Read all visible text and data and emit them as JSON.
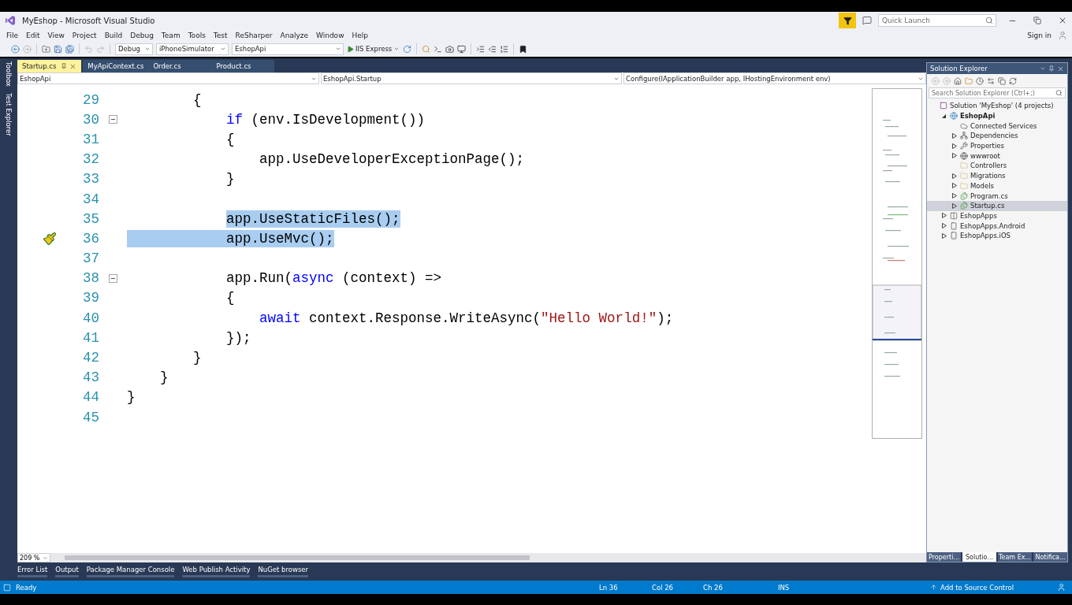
{
  "window": {
    "title": "MyEshop - Microsoft Visual Studio",
    "quick_launch": {
      "placeholder": "Quick Launch"
    },
    "sign_in": "Sign in"
  },
  "menu": [
    "File",
    "Edit",
    "View",
    "Project",
    "Build",
    "Debug",
    "Team",
    "Tools",
    "Test",
    "ReSharper",
    "Analyze",
    "Window",
    "Help"
  ],
  "toolbar": {
    "combos": [
      "Debug",
      "iPhoneSimulator",
      "EshopApi"
    ],
    "run": "IIS Express"
  },
  "side_tabs": [
    "Toolbox",
    "Test Explorer"
  ],
  "doc_tabs": [
    {
      "label": "Startup.cs",
      "selected": true
    },
    {
      "label": "MyApiContext.cs",
      "selected": false
    },
    {
      "label": "Order.cs",
      "selected": false
    },
    {
      "label": "Product.cs",
      "selected": false
    }
  ],
  "nav_bar": [
    "EshopApi",
    "EshopApi.Startup",
    "Configure(IApplicationBuilder app, IHostingEnvironment env)"
  ],
  "code": {
    "lines": [
      {
        "number": "29",
        "foldable": false,
        "marker": false,
        "selected": false,
        "tokens": [
          {
            "kind": "plain",
            "text": "        {"
          }
        ]
      },
      {
        "number": "30",
        "foldable": true,
        "marker": false,
        "selected": false,
        "tokens": [
          {
            "kind": "keyword",
            "text": "            if"
          },
          {
            "kind": "plain",
            "text": " (env.IsDevelopment())"
          }
        ]
      },
      {
        "number": "31",
        "foldable": false,
        "marker": false,
        "selected": false,
        "tokens": [
          {
            "kind": "plain",
            "text": "            {"
          }
        ]
      },
      {
        "number": "32",
        "foldable": false,
        "marker": false,
        "selected": false,
        "tokens": [
          {
            "kind": "plain",
            "text": "                app.UseDeveloperExceptionPage();"
          }
        ]
      },
      {
        "number": "33",
        "foldable": false,
        "marker": false,
        "selected": false,
        "tokens": [
          {
            "kind": "plain",
            "text": "            }"
          }
        ]
      },
      {
        "number": "34",
        "foldable": false,
        "marker": false,
        "selected": false
      },
      {
        "number": "35",
        "foldable": false,
        "marker": false,
        "selected": true,
        "full_line_selected": false,
        "tokens": [
          {
            "kind": "plain",
            "text": "            app.UseStaticFiles();"
          }
        ]
      },
      {
        "number": "36",
        "foldable": false,
        "marker": true,
        "selected": true,
        "full_line_selected": true,
        "tokens": [
          {
            "kind": "plain",
            "text": "            app.UseMvc();"
          }
        ]
      },
      {
        "number": "37",
        "foldable": false,
        "marker": false,
        "selected": false
      },
      {
        "number": "38",
        "foldable": true,
        "marker": false,
        "selected": false,
        "tokens": [
          {
            "kind": "plain",
            "text": "            app.Run("
          },
          {
            "kind": "keyword",
            "text": "async"
          },
          {
            "kind": "plain",
            "text": " (context) =>"
          }
        ]
      },
      {
        "number": "39",
        "foldable": false,
        "marker": false,
        "selected": false,
        "tokens": [
          {
            "kind": "plain",
            "text": "            {"
          }
        ]
      },
      {
        "number": "40",
        "foldable": false,
        "marker": false,
        "selected": false,
        "tokens": [
          {
            "kind": "keyword",
            "text": "                await"
          },
          {
            "kind": "plain",
            "text": " context.Response.WriteAsync("
          },
          {
            "kind": "string",
            "text": "\"Hello World!\""
          },
          {
            "kind": "plain",
            "text": ");"
          }
        ]
      },
      {
        "number": "41",
        "foldable": false,
        "marker": false,
        "selected": false,
        "tokens": [
          {
            "kind": "plain",
            "text": "            });"
          }
        ]
      },
      {
        "number": "42",
        "foldable": false,
        "marker": false,
        "selected": false,
        "tokens": [
          {
            "kind": "plain",
            "text": "        }"
          }
        ]
      },
      {
        "number": "43",
        "foldable": false,
        "marker": false,
        "selected": false,
        "tokens": [
          {
            "kind": "plain",
            "text": "    }"
          }
        ]
      },
      {
        "number": "44",
        "foldable": false,
        "marker": false,
        "selected": false,
        "tokens": [
          {
            "kind": "plain",
            "text": "}"
          }
        ]
      },
      {
        "number": "45",
        "foldable": false,
        "marker": false,
        "selected": false
      }
    ]
  },
  "zoom": "209 %",
  "solution_explorer": {
    "title": "Solution Explorer",
    "search": {
      "placeholder": "Search Solution Explorer (Ctrl+;)"
    },
    "tree": [
      {
        "label": "Solution 'MyEshop' (4 projects)",
        "kind": "solution",
        "expandable": false,
        "selected": false,
        "children": [
          {
            "label": "EshopApi",
            "kind": "webproject",
            "expandable": true,
            "expanded": true,
            "selected": false,
            "startup": true,
            "children": [
              {
                "label": "Connected Services",
                "kind": "cloud",
                "expandable": false,
                "selected": false
              },
              {
                "label": "Dependencies",
                "kind": "deps",
                "expandable": true,
                "expanded": false,
                "selected": false
              },
              {
                "label": "Properties",
                "kind": "wrench",
                "expandable": true,
                "expanded": false,
                "selected": false
              },
              {
                "label": "wwwroot",
                "kind": "globe",
                "expandable": true,
                "expanded": false,
                "selected": false
              },
              {
                "label": "Controllers",
                "kind": "folder",
                "expandable": false,
                "selected": false
              },
              {
                "label": "Migrations",
                "kind": "folder",
                "expandable": true,
                "expanded": false,
                "selected": false
              },
              {
                "label": "Models",
                "kind": "folder",
                "expandable": true,
                "expanded": false,
                "selected": false
              },
              {
                "label": "Program.cs",
                "kind": "csfile",
                "expandable": true,
                "expanded": false,
                "selected": false
              },
              {
                "label": "Startup.cs",
                "kind": "csfile",
                "expandable": true,
                "expanded": false,
                "selected": true
              }
            ]
          },
          {
            "label": "EshopApps",
            "kind": "shared",
            "expandable": true,
            "expanded": false,
            "selected": false,
            "startup": false
          },
          {
            "label": "EshopApps.Android",
            "kind": "phone",
            "expandable": true,
            "expanded": false,
            "selected": false,
            "startup": false
          },
          {
            "label": "EshopApps.iOS",
            "kind": "phone",
            "expandable": true,
            "expanded": false,
            "selected": false,
            "startup": false
          }
        ]
      }
    ],
    "tabs": [
      {
        "label": "Properti...",
        "selected": false
      },
      {
        "label": "Solutio...",
        "selected": true
      },
      {
        "label": "Team Ex...",
        "selected": false
      },
      {
        "label": "Notifica...",
        "selected": false
      }
    ]
  },
  "tool_tabs": [
    "Error List",
    "Output",
    "Package Manager Console",
    "Web Publish Activity",
    "NuGet browser"
  ],
  "status_bar": {
    "state": "Ready",
    "line": "Ln 36",
    "column": "Col 26",
    "char": "Ch 26",
    "mode": "INS",
    "source_control": "Add to Source Control"
  }
}
